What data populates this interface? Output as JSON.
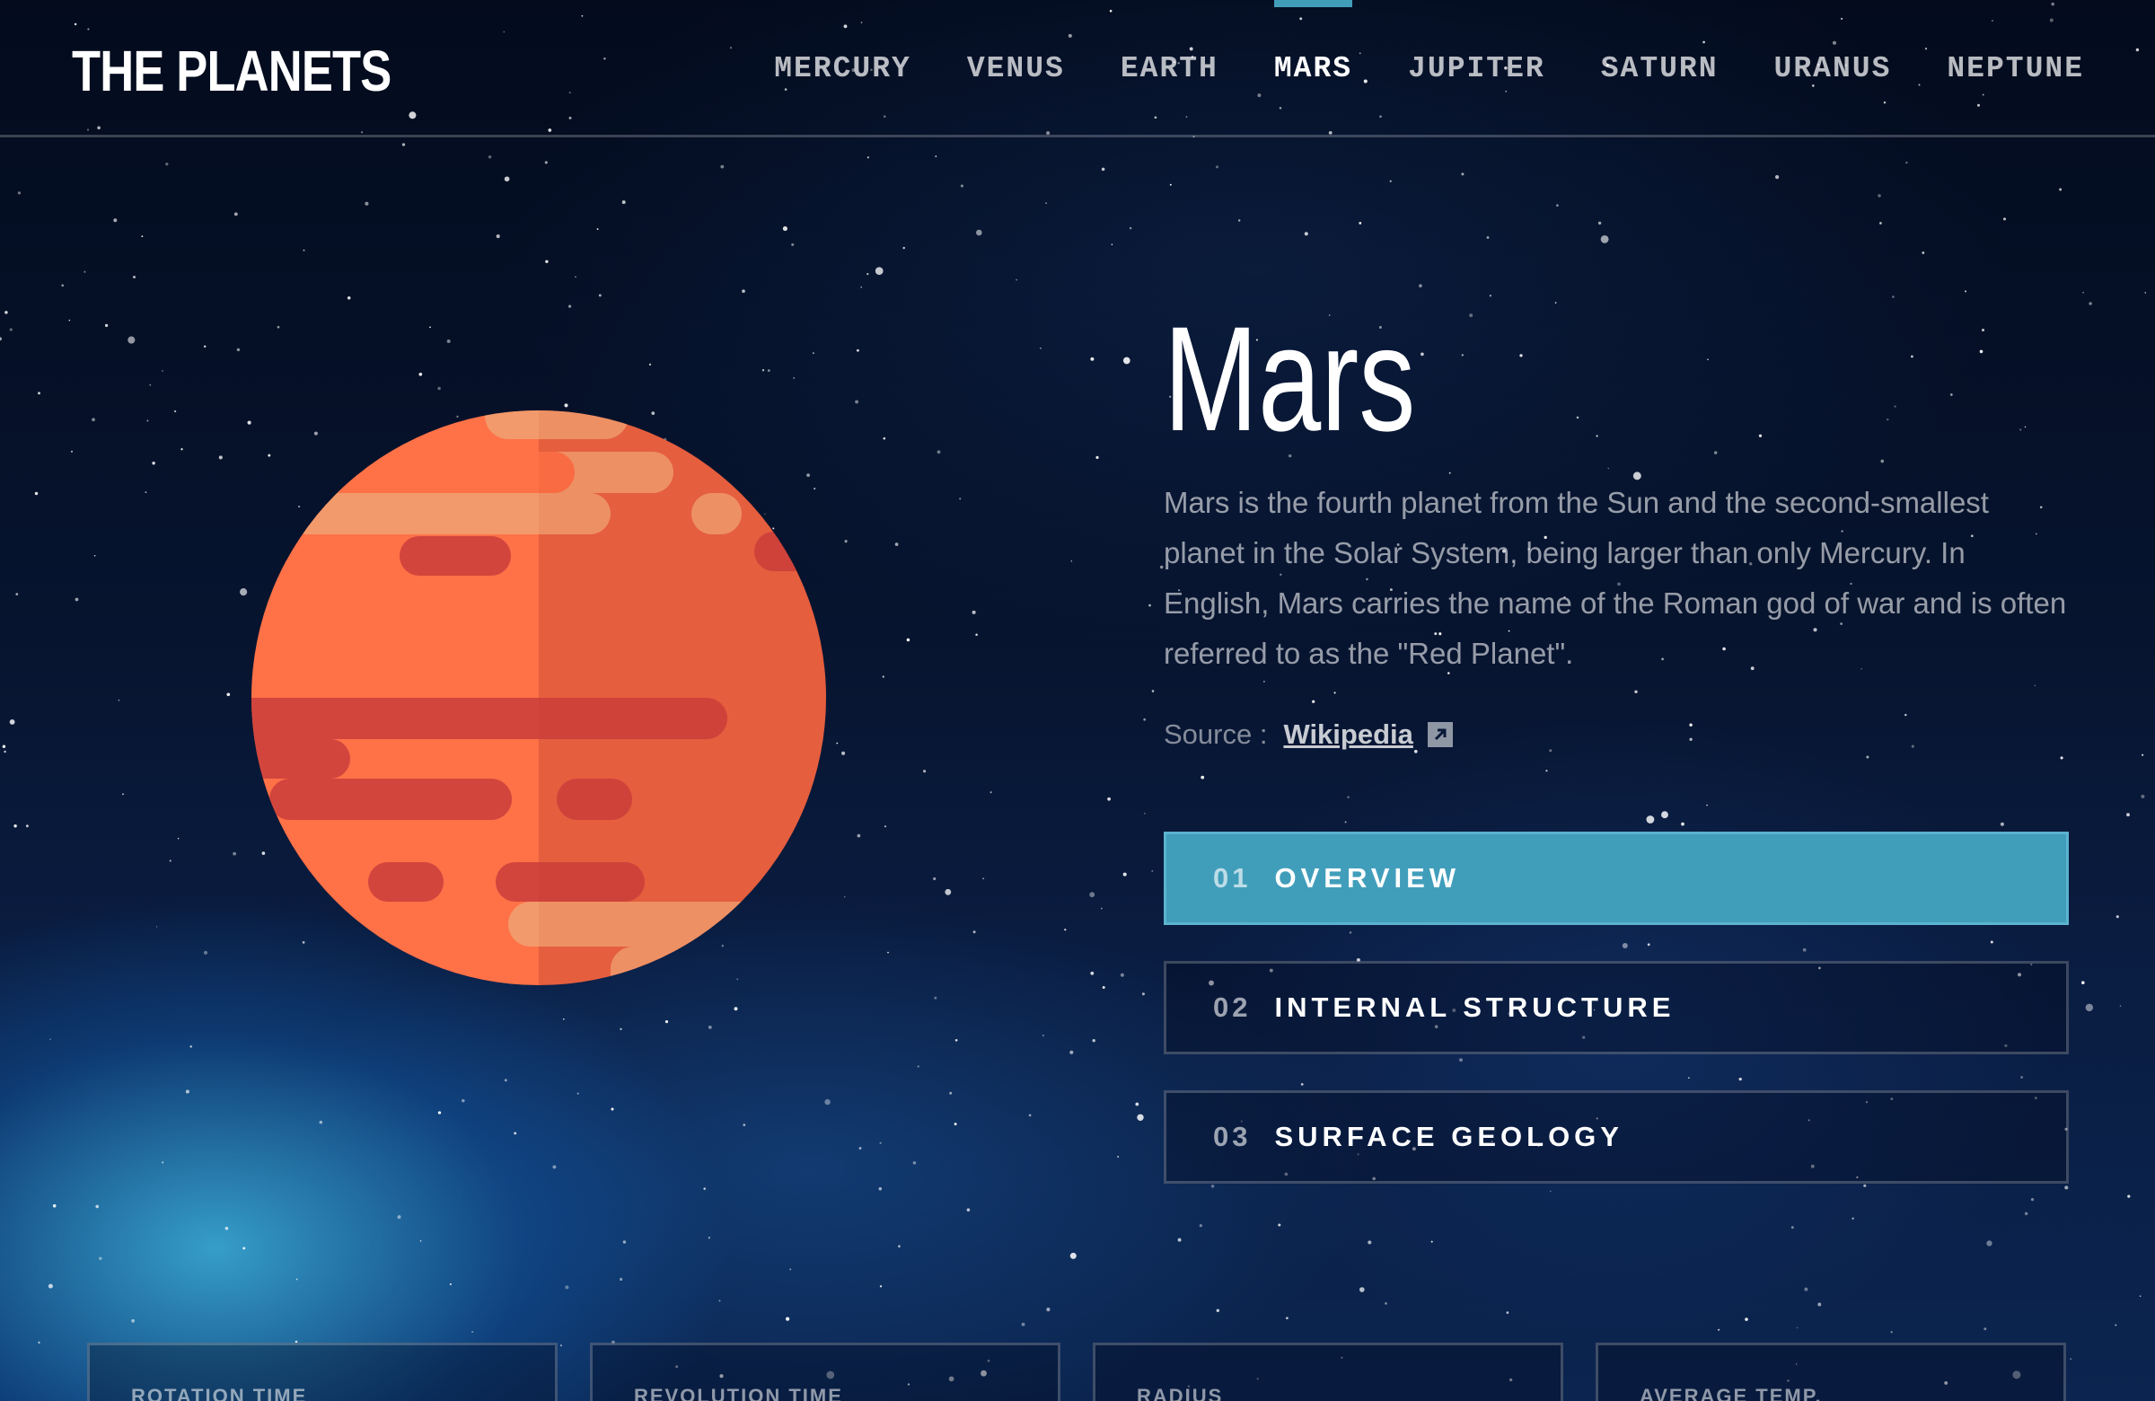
{
  "app": {
    "logo": "THE PLANETS"
  },
  "nav": {
    "items": [
      {
        "label": "MERCURY",
        "active": false
      },
      {
        "label": "VENUS",
        "active": false
      },
      {
        "label": "EARTH",
        "active": false
      },
      {
        "label": "MARS",
        "active": true
      },
      {
        "label": "JUPITER",
        "active": false
      },
      {
        "label": "SATURN",
        "active": false
      },
      {
        "label": "URANUS",
        "active": false
      },
      {
        "label": "NEPTUNE",
        "active": false
      }
    ],
    "accent_color": "#419ebb"
  },
  "planet": {
    "name": "Mars",
    "description": "Mars is the fourth planet from the Sun and the second-smallest planet in the Solar System, being larger than only Mercury. In English, Mars carries the name of the Roman god of war and is often referred to as the \"Red Planet\".",
    "source_label": "Source :",
    "source_link": "Wikipedia",
    "source_icon": "external-link-icon",
    "colors": {
      "base": "#ff7147",
      "shade": "#ea6342",
      "band": "#d2453d",
      "highlight": "#f29a6b"
    }
  },
  "tabs": [
    {
      "number": "01",
      "label": "OVERVIEW",
      "active": true
    },
    {
      "number": "02",
      "label": "INTERNAL STRUCTURE",
      "active": false
    },
    {
      "number": "03",
      "label": "SURFACE GEOLOGY",
      "active": false
    }
  ],
  "stats": [
    {
      "label": "ROTATION TIME"
    },
    {
      "label": "REVOLUTION TIME"
    },
    {
      "label": "RADIUS"
    },
    {
      "label": "AVERAGE TEMP."
    }
  ]
}
